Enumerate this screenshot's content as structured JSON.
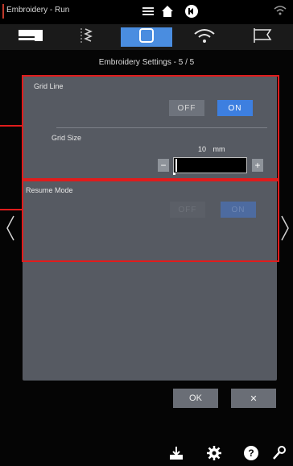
{
  "topbar": {
    "title": "Embroidery - Run"
  },
  "tabs": [
    {
      "name": "sewing"
    },
    {
      "name": "stitch"
    },
    {
      "name": "embroidery",
      "active": true
    },
    {
      "name": "wifi"
    },
    {
      "name": "flag"
    }
  ],
  "subtitle": "Embroidery Settings - 5 / 5",
  "grid_line": {
    "label": "Grid Line",
    "off_label": "OFF",
    "on_label": "ON",
    "grid_size_label": "Grid Size",
    "grid_size_value": "10",
    "grid_size_unit": "mm"
  },
  "resume_mode": {
    "label": "Resume Mode",
    "off_label": "OFF",
    "on_label": "ON"
  },
  "buttons": {
    "ok": "OK",
    "close": "✕"
  },
  "colors": {
    "accent": "#3d7fe0",
    "highlight_frame": "#e01c1c",
    "panel": "#565a62"
  }
}
